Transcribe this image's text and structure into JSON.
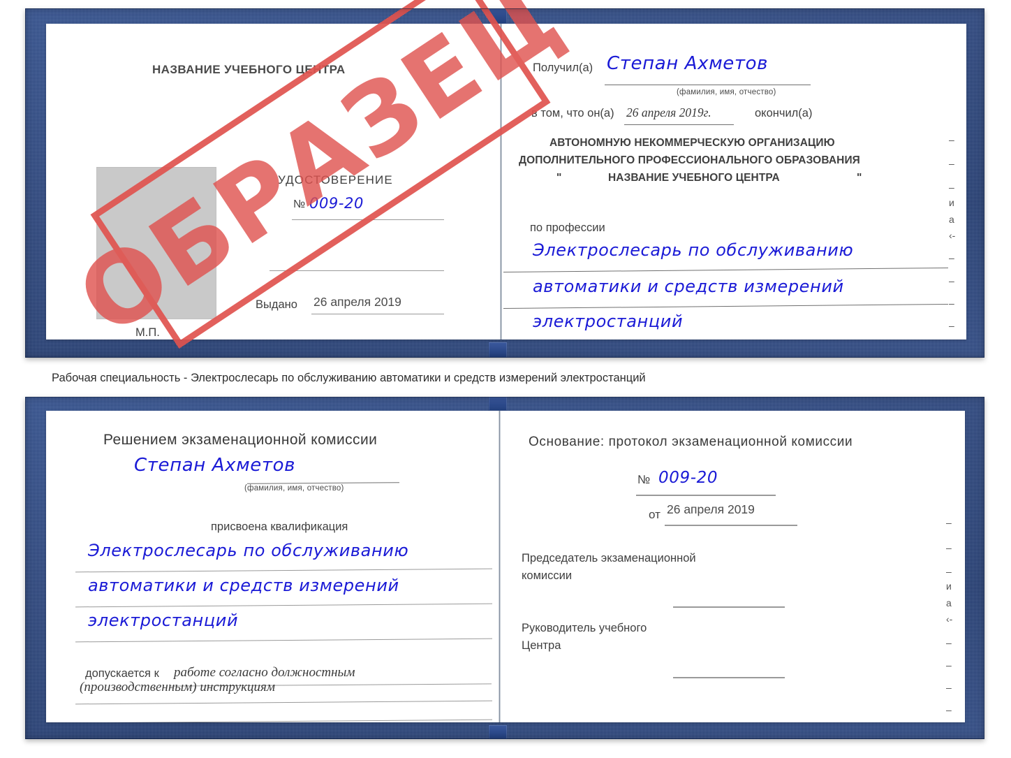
{
  "document": {
    "type": "udostoverenie-certificate",
    "stamp_label": "ОБРАЗЕЦ",
    "accent_red": "#e0534f",
    "cover_blue": "#27437f",
    "ink_blue": "#1a1ad6"
  },
  "caption": {
    "text": "Рабочая специальность - Электрослесарь по обслуживанию автоматики и средств измерений электростанций"
  },
  "cert_top": {
    "left_page": {
      "center_title": "НАЗВАНИЕ УЧЕБНОГО ЦЕНТРА",
      "doc_title": "УДОСТОВЕРЕНИЕ",
      "number_symbol": "№",
      "number_value": "009-20",
      "issued_label": "Выдано",
      "issued_value": "26 апреля 2019",
      "seal_label": "М.П.",
      "photo_placeholder": ""
    },
    "right_page": {
      "received_label": "Получил(а)",
      "received_value": "Степан Ахметов",
      "fio_hint": "(фамилия, имя, отчество)",
      "in_that_label": "в том, что он(а)",
      "in_that_value": "26 апреля 2019г.",
      "finished_label": "окончил(а)",
      "org_line1": "АВТОНОМНУЮ НЕКОММЕРЧЕСКУЮ ОРГАНИЗАЦИЮ",
      "org_line2": "ДОПОЛНИТЕЛЬНОГО ПРОФЕССИОНАЛЬНОГО ОБРАЗОВАНИЯ",
      "org_quote_open": "\"",
      "org_line3": "НАЗВАНИЕ УЧЕБНОГО ЦЕНТРА",
      "org_quote_close": "\"",
      "profession_label": "по профессии",
      "profession_line1": "Электрослесарь по обслуживанию",
      "profession_line2": "автоматики и средств измерений",
      "profession_line3": "электростанций",
      "edge_fragments": [
        "–",
        "–",
        "–",
        "и",
        "а",
        "‹-",
        "–",
        "–",
        "–",
        "–"
      ]
    }
  },
  "cert_bottom": {
    "left_page": {
      "heading": "Решением экзаменационной комиссии",
      "name_value": "Степан Ахметов",
      "fio_hint": "(фамилия, имя, отчество)",
      "qualification_label": "присвоена квалификация",
      "qualification_line1": "Электрослесарь по обслуживанию",
      "qualification_line2": "автоматики и средств измерений",
      "qualification_line3": "электростанций",
      "admitted_label": "допускается к",
      "admitted_value_line1": "работе согласно должностным",
      "admitted_value_line2": "(производственным) инструкциям"
    },
    "right_page": {
      "basis_label": "Основание: протокол экзаменационной комиссии",
      "number_symbol": "№",
      "number_value": "009-20",
      "date_label": "от",
      "date_value": "26 апреля 2019",
      "chairman_line1": "Председатель экзаменационной",
      "chairman_line2": "комиссии",
      "head_line1": "Руководитель учебного",
      "head_line2": "Центра",
      "edge_fragments": [
        "–",
        "–",
        "–",
        "и",
        "а",
        "‹-",
        "–",
        "–",
        "–",
        "–"
      ]
    }
  }
}
